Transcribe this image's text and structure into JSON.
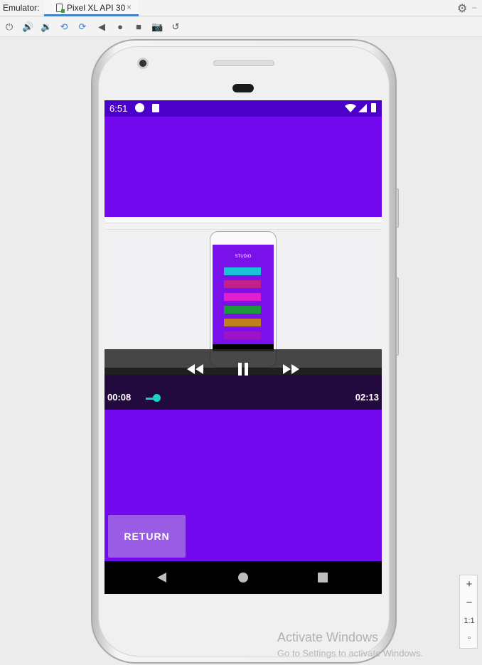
{
  "ide": {
    "emulator_label": "Emulator:",
    "tab_title": "Pixel XL API 30",
    "tab_close": "×",
    "settings_icon": "gear-icon",
    "toolbar_icons": [
      "power-icon",
      "volume-up-icon",
      "volume-down-icon",
      "rotate-left-icon",
      "rotate-right-icon",
      "back-icon",
      "home-icon",
      "overview-icon",
      "screenshot-icon",
      "snapshot-icon"
    ]
  },
  "device": {
    "status": {
      "time": "6:51"
    },
    "video": {
      "current_time": "00:08",
      "total_time": "02:13",
      "progress": 0.06,
      "embedded_app_title": "STUDIO",
      "embedded_buttons": [
        {
          "color": "#1ac2d6"
        },
        {
          "color": "#c2208a"
        },
        {
          "color": "#e020d0"
        },
        {
          "color": "#1a9a3a"
        },
        {
          "color": "#c08020"
        },
        {
          "color": "#a012c8"
        }
      ]
    },
    "return_button": "RETURN",
    "accent_color": "#7209ee",
    "seek_color": "#18d2c8"
  },
  "zoom": {
    "in": "+",
    "out": "−",
    "actual": "1:1"
  },
  "watermark": {
    "line1": "Activate Windows",
    "line2": "Go to Settings to activate Windows."
  }
}
